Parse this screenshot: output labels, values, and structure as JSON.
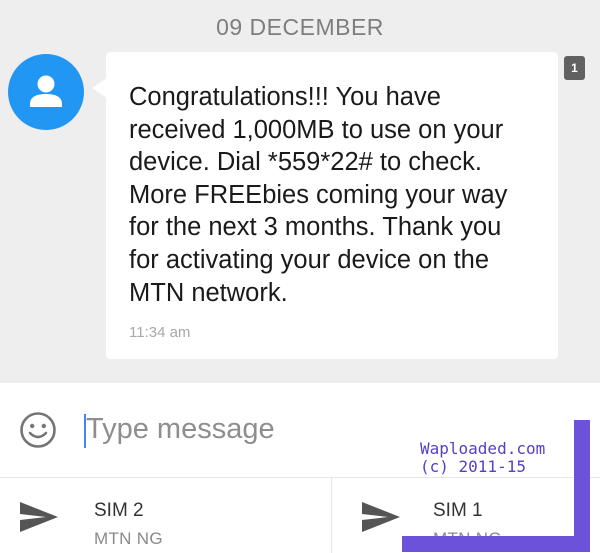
{
  "thread": {
    "date_header": "09 DECEMBER",
    "message": {
      "text": "Congratulations!!! You have received 1,000MB to use on your device. Dial *559*22# to check. More FREEbies coming your way for the next 3 months. Thank you for activating your device on the MTN network.",
      "time": "11:34 am",
      "sim_badge": "1",
      "avatar_icon": "person-icon"
    }
  },
  "compose": {
    "placeholder": "Type message",
    "emoji_icon": "smiley-icon"
  },
  "send_options": [
    {
      "sim": "SIM 2",
      "network": "MTN NG",
      "icon": "send-icon"
    },
    {
      "sim": "SIM 1",
      "network": "MTN NG",
      "icon": "send-icon"
    }
  ],
  "watermark": {
    "site": "Waploaded.com",
    "copyright": "(c) 2011-15",
    "color": "#6b52d8"
  },
  "colors": {
    "accent": "#2196f3",
    "background": "#eeeeee",
    "bubble": "#ffffff"
  }
}
